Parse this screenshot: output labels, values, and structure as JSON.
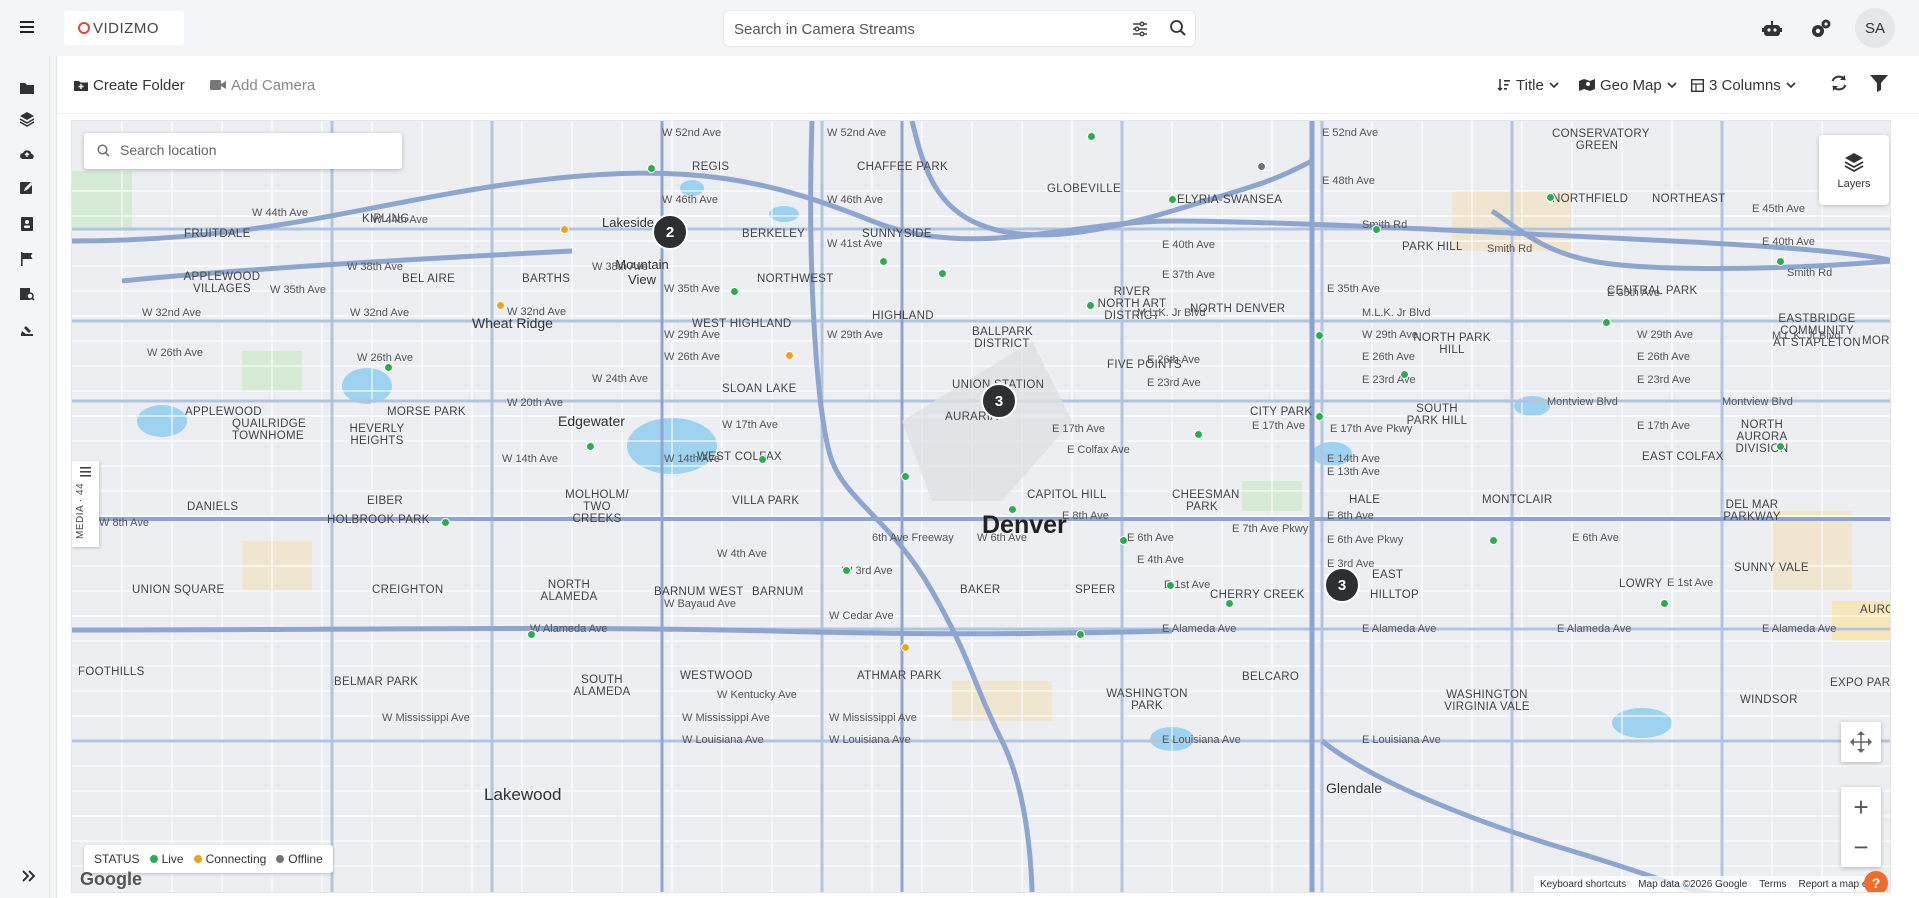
{
  "header": {
    "logo_text": "VIDIZMO",
    "search_placeholder": "Search in Camera Streams",
    "avatar_initials": "SA"
  },
  "toolbar": {
    "create_folder": "Create Folder",
    "add_camera": "Add Camera",
    "sort_label": "Title",
    "view_label": "Geo Map",
    "columns_label": "3 Columns"
  },
  "map": {
    "location_placeholder": "Search location",
    "layers_label": "Layers",
    "media_tab_label": "MEDIA · 44",
    "status_title": "STATUS",
    "status_live": "Live",
    "status_connecting": "Connecting",
    "status_offline": "Offline",
    "google": "Google",
    "attribution": {
      "shortcuts": "Keyboard shortcuts",
      "data": "Map data ©2026 Google",
      "terms": "Terms",
      "report": "Report a map e"
    },
    "help": "?",
    "zoom_in": "+",
    "zoom_out": "−",
    "colors": {
      "live": "#2eaa4f",
      "connecting": "#f0a21f",
      "offline": "#6f747b",
      "cluster": "#2d2f33"
    },
    "clusters": [
      "2",
      "3",
      "3"
    ],
    "labels": {
      "denver": "Denver",
      "lakewood": "Lakewood",
      "wheat_ridge": "Wheat Ridge",
      "edgewater": "Edgewater",
      "lakeside": "Lakeside",
      "mountain_view": "Mountain View",
      "glendale": "Glendale",
      "regis": "REGIS",
      "chaffee_park": "CHAFFEE PARK",
      "globeville": "GLOBEVILLE",
      "elyria": "ELYRIA-SWANSEA",
      "kipling": "KIPLING",
      "fruitdale": "FRUITDALE",
      "berkeley": "BERKELEY",
      "sunnyside": "SUNNYSIDE",
      "applewood": "APPLEWOOD VILLAGES",
      "bel_aire": "BEL AIRE",
      "barths": "BARTHS",
      "northwest": "NORTHWEST",
      "highland": "HIGHLAND",
      "west_highland": "WEST HIGHLAND",
      "river_north": "RIVER NORTH ART DISTRICT",
      "north_denver": "NORTH DENVER",
      "northfield": "NORTHFIELD",
      "northeast": "NORTHEAST",
      "park_hill": "PARK HILL",
      "central_park": "CENTRAL PARK",
      "conservatory": "CONSERVATORY GREEN",
      "ballpark": "BALLPARK DISTRICT",
      "five_points": "FIVE POINTS",
      "north_park_hill": "NORTH PARK HILL",
      "eastbridge": "EASTBRIDGE COMMUNITY AT STAPLETON",
      "morris": "MORRIS",
      "union_station": "UNION STATION",
      "auraria": "AURARIA",
      "sloan_lake": "SLOAN LAKE",
      "city_park": "CITY PARK",
      "south_park_hill": "SOUTH PARK HILL",
      "north_aurora": "NORTH AURORA DIVISION",
      "applewood2": "APPLEWOOD",
      "quailridge": "QUAILRIDGE TOWNHOME",
      "morse_park": "MORSE PARK",
      "heverly": "HEVERLY HEIGHTS",
      "west_colfax": "WEST COLFAX",
      "east_colfax": "EAST COLFAX",
      "molholm": "MOLHOLM/ TWO CREEKS",
      "villa_park": "VILLA PARK",
      "capitol_hill": "CAPITOL HILL",
      "cheesman": "CHEESMAN PARK",
      "hale": "HALE",
      "montclair": "MONTCLAIR",
      "del_mar": "DEL MAR PARKWAY",
      "eiber": "EIBER",
      "daniels": "DANIELS",
      "holbrook": "HOLBROOK PARK",
      "union_square": "UNION SQUARE",
      "creighton": "CREIGHTON",
      "north_alameda": "NORTH ALAMEDA",
      "barnum_west": "BARNUM WEST",
      "barnum": "BARNUM",
      "baker": "BAKER",
      "speer": "SPEER",
      "cherry_creek": "CHERRY CREEK",
      "east": "EAST",
      "hilltop": "HILLTOP",
      "lowry": "LOWRY",
      "sunny_vale": "SUNNY VALE",
      "aurora": "AURORA",
      "foothills": "FOOTHILLS",
      "belmar": "BELMAR PARK",
      "south_alameda": "SOUTH ALAMEDA",
      "westwood": "WESTWOOD",
      "athmar": "ATHMAR PARK",
      "washington_park": "WASHINGTON PARK",
      "belcaro": "BELCARO",
      "washington_virginia": "WASHINGTON VIRGINIA VALE",
      "windsor": "WINDSOR",
      "expo_park": "EXPO PAR",
      "w52": "W 52nd Ave",
      "w46": "W 46th Ave",
      "w44": "W 44th Ave",
      "w41": "W 41st Ave",
      "w38": "W 38th Ave",
      "w35": "W 35th Ave",
      "w32": "W 32nd Ave",
      "w29": "W 29th Ave",
      "w26": "W 26th Ave",
      "w24": "W 24th Ave",
      "w20": "W 20th Ave",
      "w17": "W 17th Ave",
      "w14": "W 14th Ave",
      "w8": "W 8th Ave",
      "w6": "W 6th Ave",
      "w4": "W 4th Ave",
      "w3": "W 3rd Ave",
      "bayaud": "W Bayaud Ave",
      "cedar": "W Cedar Ave",
      "w_alameda": "W Alameda Ave",
      "kentucky": "W Kentucky Ave",
      "mississippi": "W Mississippi Ave",
      "louisiana": "W Louisiana Ave",
      "e52": "E 52nd Ave",
      "e48": "E 48th Ave",
      "e45": "E 45th Ave",
      "e40": "E 40th Ave",
      "e37": "E 37th Ave",
      "e35": "E 35th Ave",
      "e26": "E 26th Ave",
      "e23": "E 23rd Ave",
      "e17": "E 17th Ave",
      "e17p": "E 17th Ave Pkwy",
      "colfax": "E Colfax Ave",
      "e14": "E 14th Ave",
      "e13": "E 13th Ave",
      "e8": "E 8th Ave",
      "e7p": "E 7th Ave Pkwy",
      "e6": "E 6th Ave",
      "e6p": "E 6th Ave Pkwy",
      "e4": "E 4th Ave",
      "e3": "E 3rd Ave",
      "e1": "E 1st Ave",
      "e_alameda": "E Alameda Ave",
      "e_louisiana": "E Louisiana Ave",
      "smith_rd": "Smith Rd",
      "mlk": "M.L.K. Jr Blvd",
      "freeway": "6th Ave Freeway",
      "montview": "Montview Blvd"
    }
  }
}
